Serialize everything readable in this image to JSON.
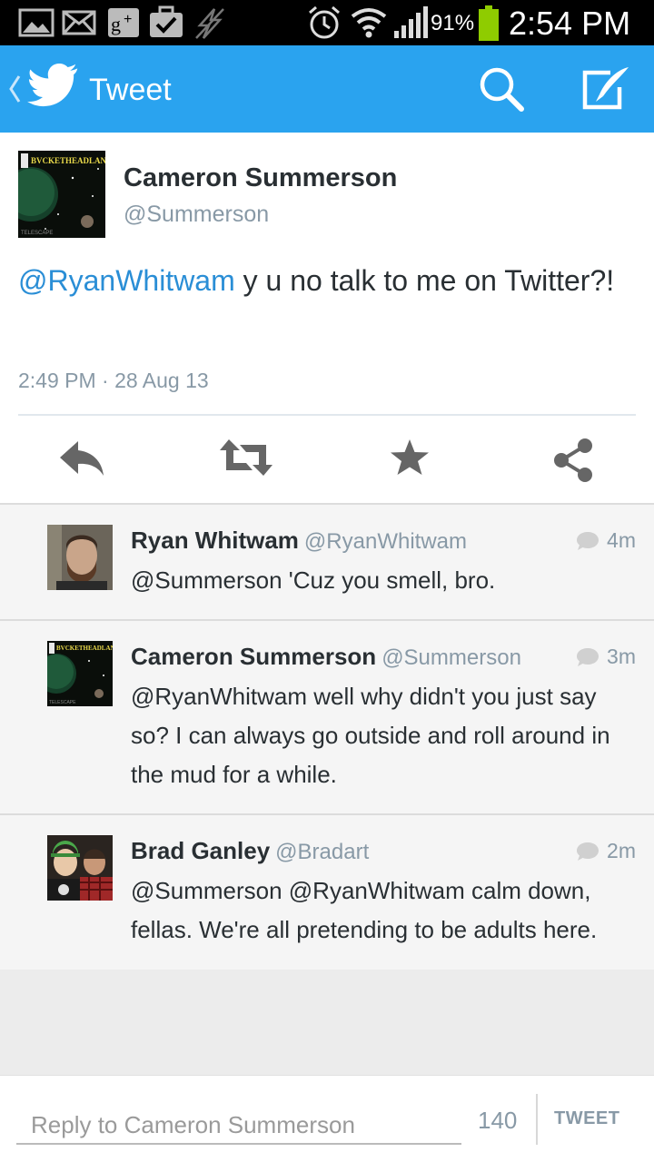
{
  "status_bar": {
    "battery_pct": "91%",
    "time": "2:54 PM",
    "icons": [
      "gallery-icon",
      "mail-icon",
      "google-plus-icon",
      "briefcase-check-icon",
      "no-sync-icon",
      "alarm-icon",
      "wifi-icon",
      "signal-icon",
      "battery-icon"
    ]
  },
  "action_bar": {
    "title": "Tweet",
    "color": "#2aa3ef"
  },
  "tweet": {
    "author_name": "Cameron Summerson",
    "author_handle": "@Summerson",
    "mention": "@RyanWhitwam",
    "text": " y u no talk to me on Twitter?!",
    "timestamp": "2:49 PM · 28 Aug 13"
  },
  "replies": [
    {
      "name": "Ryan Whitwam",
      "handle": "@RyanWhitwam",
      "time": "4m",
      "text": "@Summerson 'Cuz you smell, bro."
    },
    {
      "name": "Cameron Summerson",
      "handle": "@Summerson",
      "time": "3m",
      "text": "@RyanWhitwam well why didn't you just say so? I can always go outside and roll around in the mud for a while."
    },
    {
      "name": "Brad Ganley",
      "handle": "@Bradart",
      "time": "2m",
      "text": "@Summerson @RyanWhitwam calm down, fellas. We're all pretending to be adults here."
    }
  ],
  "compose": {
    "placeholder": "Reply to Cameron Summerson",
    "char_count": "140",
    "button_label": "TWEET"
  }
}
